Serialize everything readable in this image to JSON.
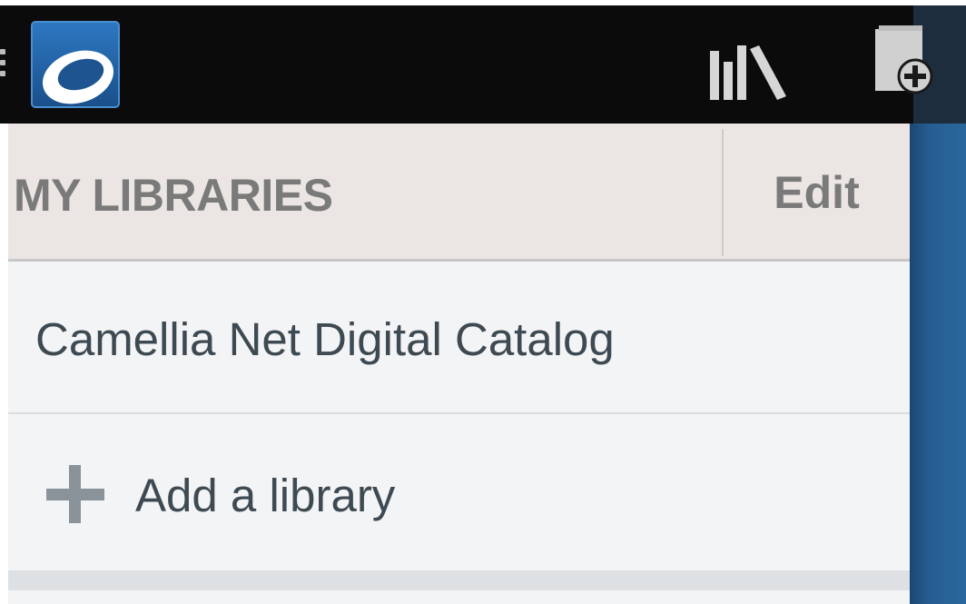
{
  "topbar": {
    "logo_icon": "overdrive-logo-icon",
    "bookshelf_icon": "bookshelf-icon",
    "add_title_icon": "add-title-icon",
    "menu_icon": "overflow-menu-icon"
  },
  "drawer": {
    "section_title": "MY LIBRARIES",
    "edit_label": "Edit",
    "libraries": [
      {
        "name": "Camellia Net Digital Catalog"
      }
    ],
    "add_library_label": "Add a library",
    "add_icon": "plus-icon"
  },
  "colors": {
    "topbar_bg": "#0b0b0b",
    "header_bg": "#ebe5e3",
    "drawer_bg": "#f3f4f6",
    "text_primary": "#3e4a52",
    "text_header": "#7a7a7a",
    "accent_blue": "#265e92"
  }
}
